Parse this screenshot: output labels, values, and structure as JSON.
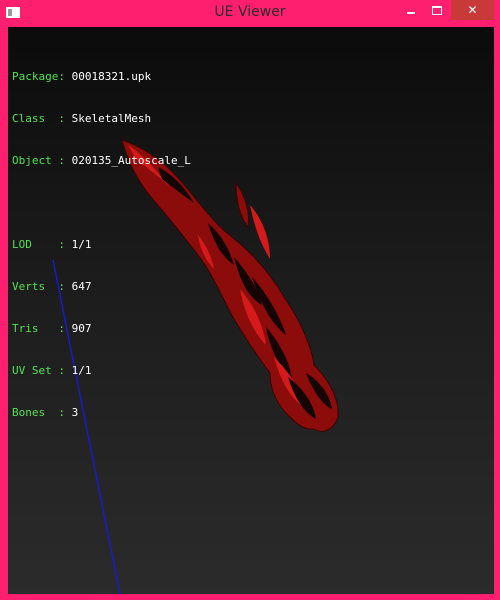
{
  "window": {
    "title": "UE Viewer",
    "accent_color": "#ff1f6e",
    "controls": {
      "minimize_icon": "minimize-icon",
      "maximize_icon": "maximize-icon",
      "close_icon": "close-icon",
      "close_glyph": "✕"
    }
  },
  "info": {
    "group1": [
      {
        "label": "Package: ",
        "value": "00018321.upk"
      },
      {
        "label": "Class  : ",
        "value": "SkeletalMesh"
      },
      {
        "label": "Object : ",
        "value": "020135_Autoscale_L"
      }
    ],
    "group2": [
      {
        "label": "LOD    : ",
        "value": "1/1"
      },
      {
        "label": "Verts  : ",
        "value": "647"
      },
      {
        "label": "Tris   : ",
        "value": "907"
      },
      {
        "label": "UV Set : ",
        "value": "1/1"
      },
      {
        "label": "Bones  : ",
        "value": "3"
      }
    ],
    "label_color": "#55e055",
    "value_color": "#ffffff"
  },
  "viewport": {
    "mesh_colors": {
      "main": "#8c0b0b",
      "dark": "#140404",
      "highlight": "#d41a1a"
    },
    "axis_line_color": "#1a1acc"
  }
}
